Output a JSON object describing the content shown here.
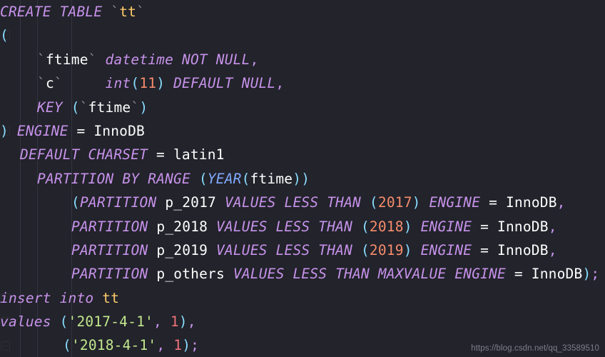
{
  "editor": {
    "background": "#22232b",
    "language": "sql",
    "watermark": "https://blog.csdn.net/qq_33589510"
  },
  "palette": {
    "keyword": "#c792ea",
    "function": "#82aaff",
    "identifier": "#ffcb6b",
    "plain_text": "#ffffff",
    "number": "#f78c6c",
    "value_number": "#f07178",
    "string": "#c3e88d",
    "punctuation": "#89ddff",
    "backtick": "#8d8f99",
    "indent_guide": "#33353f"
  },
  "lines": [
    {
      "n": 1,
      "indent": 0,
      "fold": true,
      "tokens": [
        {
          "t": "CREATE TABLE ",
          "c": "kw"
        },
        {
          "t": "`",
          "c": "tick"
        },
        {
          "t": "tt",
          "c": "id"
        },
        {
          "t": "`",
          "c": "tick"
        }
      ]
    },
    {
      "n": 2,
      "indent": 0,
      "fold": true,
      "tokens": [
        {
          "t": "(",
          "c": "punc"
        }
      ]
    },
    {
      "n": 3,
      "indent": 52,
      "fold": false,
      "tokens": [
        {
          "t": "`",
          "c": "tick"
        },
        {
          "t": "ftime",
          "c": "plain"
        },
        {
          "t": "` ",
          "c": "tick"
        },
        {
          "t": "datetime NOT NULL",
          "c": "kw"
        },
        {
          "t": ",",
          "c": "comma"
        }
      ]
    },
    {
      "n": 4,
      "indent": 52,
      "fold": false,
      "tokens": [
        {
          "t": "`",
          "c": "tick"
        },
        {
          "t": "c",
          "c": "plain"
        },
        {
          "t": "`     ",
          "c": "tick"
        },
        {
          "t": "int",
          "c": "kw"
        },
        {
          "t": "(",
          "c": "punc"
        },
        {
          "t": "11",
          "c": "num"
        },
        {
          "t": ") ",
          "c": "punc"
        },
        {
          "t": "DEFAULT NULL",
          "c": "kw"
        },
        {
          "t": ",",
          "c": "comma"
        }
      ]
    },
    {
      "n": 5,
      "indent": 52,
      "fold": false,
      "tokens": [
        {
          "t": "KEY ",
          "c": "kw"
        },
        {
          "t": "(",
          "c": "punc"
        },
        {
          "t": "`",
          "c": "tick"
        },
        {
          "t": "ftime",
          "c": "plain"
        },
        {
          "t": "`",
          "c": "tick"
        },
        {
          "t": ")",
          "c": "punc"
        }
      ]
    },
    {
      "n": 6,
      "indent": 0,
      "fold": true,
      "tokens": [
        {
          "t": ") ",
          "c": "punc"
        },
        {
          "t": "ENGINE",
          "c": "kw"
        },
        {
          "t": " = ",
          "c": "op"
        },
        {
          "t": "InnoDB",
          "c": "plain"
        }
      ]
    },
    {
      "n": 7,
      "indent": 28,
      "fold": false,
      "tokens": [
        {
          "t": "DEFAULT CHARSET",
          "c": "kw"
        },
        {
          "t": " = ",
          "c": "op"
        },
        {
          "t": "latin1",
          "c": "plain"
        }
      ]
    },
    {
      "n": 8,
      "indent": 52,
      "fold": false,
      "tokens": [
        {
          "t": "PARTITION BY RANGE ",
          "c": "kw"
        },
        {
          "t": "(",
          "c": "punc"
        },
        {
          "t": "YEAR",
          "c": "fn"
        },
        {
          "t": "(",
          "c": "punc"
        },
        {
          "t": "ftime",
          "c": "plain"
        },
        {
          "t": "))",
          "c": "punc"
        }
      ]
    },
    {
      "n": 9,
      "indent": 100,
      "fold": false,
      "tokens": [
        {
          "t": "(",
          "c": "punc"
        },
        {
          "t": "PARTITION ",
          "c": "kw"
        },
        {
          "t": "p_2017",
          "c": "plain"
        },
        {
          "t": " VALUES LESS THAN ",
          "c": "kw"
        },
        {
          "t": "(",
          "c": "punc"
        },
        {
          "t": "2017",
          "c": "num"
        },
        {
          "t": ") ",
          "c": "punc"
        },
        {
          "t": "ENGINE",
          "c": "kw"
        },
        {
          "t": " = ",
          "c": "op"
        },
        {
          "t": "InnoDB",
          "c": "plain"
        },
        {
          "t": ",",
          "c": "comma"
        }
      ]
    },
    {
      "n": 10,
      "indent": 100,
      "fold": false,
      "tokens": [
        {
          "t": "PARTITION ",
          "c": "kw"
        },
        {
          "t": "p_2018",
          "c": "plain"
        },
        {
          "t": " VALUES LESS THAN ",
          "c": "kw"
        },
        {
          "t": "(",
          "c": "punc"
        },
        {
          "t": "2018",
          "c": "num"
        },
        {
          "t": ") ",
          "c": "punc"
        },
        {
          "t": "ENGINE",
          "c": "kw"
        },
        {
          "t": " = ",
          "c": "op"
        },
        {
          "t": "InnoDB",
          "c": "plain"
        },
        {
          "t": ",",
          "c": "comma"
        }
      ]
    },
    {
      "n": 11,
      "indent": 100,
      "fold": false,
      "tokens": [
        {
          "t": "PARTITION ",
          "c": "kw"
        },
        {
          "t": "p_2019",
          "c": "plain"
        },
        {
          "t": " VALUES LESS THAN ",
          "c": "kw"
        },
        {
          "t": "(",
          "c": "punc"
        },
        {
          "t": "2019",
          "c": "num"
        },
        {
          "t": ") ",
          "c": "punc"
        },
        {
          "t": "ENGINE",
          "c": "kw"
        },
        {
          "t": " = ",
          "c": "op"
        },
        {
          "t": "InnoDB",
          "c": "plain"
        },
        {
          "t": ",",
          "c": "comma"
        }
      ]
    },
    {
      "n": 12,
      "indent": 100,
      "fold": false,
      "tokens": [
        {
          "t": "PARTITION ",
          "c": "kw"
        },
        {
          "t": "p_others",
          "c": "plain"
        },
        {
          "t": " VALUES LESS THAN MAXVALUE ENGINE",
          "c": "kw"
        },
        {
          "t": " = ",
          "c": "op"
        },
        {
          "t": "InnoDB",
          "c": "plain"
        },
        {
          "t": ")",
          "c": "punc"
        },
        {
          "t": ";",
          "c": "comma"
        }
      ]
    },
    {
      "n": 13,
      "indent": 0,
      "fold": true,
      "tokens": [
        {
          "t": "insert into ",
          "c": "kw"
        },
        {
          "t": "tt",
          "c": "id"
        }
      ]
    },
    {
      "n": 14,
      "indent": 0,
      "fold": true,
      "tokens": [
        {
          "t": "values ",
          "c": "kw"
        },
        {
          "t": "(",
          "c": "punc"
        },
        {
          "t": "'2017-4-1'",
          "c": "str"
        },
        {
          "t": ", ",
          "c": "comma"
        },
        {
          "t": "1",
          "c": "num2"
        },
        {
          "t": ")",
          "c": "punc"
        },
        {
          "t": ",",
          "c": "comma"
        }
      ]
    },
    {
      "n": 15,
      "indent": 88,
      "fold": true,
      "tokens": [
        {
          "t": "(",
          "c": "punc"
        },
        {
          "t": "'2018-4-1'",
          "c": "str"
        },
        {
          "t": ", ",
          "c": "comma"
        },
        {
          "t": "1",
          "c": "num2"
        },
        {
          "t": ")",
          "c": "punc"
        },
        {
          "t": ";",
          "c": "comma"
        }
      ]
    }
  ],
  "indent_guides": [
    28,
    52,
    100
  ],
  "sql_statements": {
    "create_table": "CREATE TABLE `tt` ( `ftime` datetime NOT NULL, `c` int(11) DEFAULT NULL, KEY (`ftime`) ) ENGINE = InnoDB DEFAULT CHARSET = latin1 PARTITION BY RANGE (YEAR(ftime)) (PARTITION p_2017 VALUES LESS THAN (2017) ENGINE = InnoDB, PARTITION p_2018 VALUES LESS THAN (2018) ENGINE = InnoDB, PARTITION p_2019 VALUES LESS THAN (2019) ENGINE = InnoDB, PARTITION p_others VALUES LESS THAN MAXVALUE ENGINE = InnoDB);",
    "insert": "insert into tt values ('2017-4-1', 1), ('2018-4-1', 1);",
    "table_name": "tt",
    "columns": [
      "ftime",
      "c"
    ],
    "partitions": [
      "p_2017",
      "p_2018",
      "p_2019",
      "p_others"
    ],
    "partition_values": [
      "2017",
      "2018",
      "2019",
      "MAXVALUE"
    ],
    "engine": "InnoDB",
    "charset": "latin1"
  }
}
